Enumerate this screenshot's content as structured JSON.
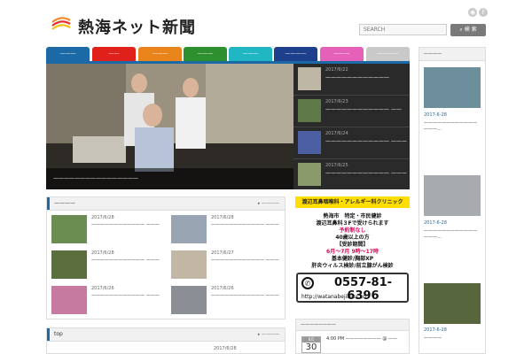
{
  "header": {
    "site_title": "熱海ネット新聞",
    "search_placeholder": "SEARCH",
    "search_button": "検 索",
    "rss_icon": "rss-icon",
    "facebook_icon": "facebook-icon"
  },
  "nav": {
    "tabs": [
      {
        "label": "———",
        "color": "#1b6aa7"
      },
      {
        "label": "——",
        "color": "#e0201a"
      },
      {
        "label": "———",
        "color": "#e8841a"
      },
      {
        "label": "———",
        "color": "#2e8f2e"
      },
      {
        "label": "———",
        "color": "#21b6c4"
      },
      {
        "label": "————",
        "color": "#1d3f8c"
      },
      {
        "label": "———",
        "color": "#e560b8"
      },
      {
        "label": "————",
        "color": "#c9c9c9"
      }
    ]
  },
  "slider": {
    "caption": "————————————————",
    "items": [
      {
        "date": "2017/6/22",
        "text": "————————————"
      },
      {
        "date": "2017/6/23",
        "text": "———————————— ——"
      },
      {
        "date": "2017/6/24",
        "text": "———————————— ———"
      },
      {
        "date": "2017/6/25",
        "text": "———————————— ———"
      }
    ]
  },
  "section1": {
    "title": "————",
    "more": "▸ ————",
    "cards": [
      {
        "date": "2017/6/28",
        "text": "———————————— ———"
      },
      {
        "date": "2017/6/28",
        "text": "———————————— ———"
      },
      {
        "date": "2017/6/28",
        "text": "———————————— ———"
      },
      {
        "date": "2017/6/27",
        "text": "———————————— ———"
      },
      {
        "date": "2017/6/26",
        "text": "———————————— ———"
      },
      {
        "date": "2017/6/26",
        "text": "———————————— ———"
      }
    ]
  },
  "section2": {
    "title": "top",
    "more": "▸ ————",
    "card_date": "2017/6/28"
  },
  "ad": {
    "head": "渡辺耳鼻咽喉科・アレルギー科クリニック",
    "line1": "熱海市　特定・市民健診",
    "line2": "渡辺耳鼻科３Fで受けられます",
    "line3": "予約制なし",
    "line4": "40歳以上の方",
    "line5": "【受診期間】",
    "line6": "6月～7月 9時～17時",
    "line7": "基本健診/胸部XP",
    "line8": "肝炎ウィルス検診/前立腺がん検診",
    "phone": "0557-81-6396",
    "url": "http://watanabejibika.co"
  },
  "calendar": {
    "title": "————————",
    "month": "6月",
    "day": "30",
    "event": "4:00 PM ———————— @ ——"
  },
  "sidebar": {
    "title": "————",
    "posts": [
      {
        "date": "2017-6-28",
        "text": "———————————— ———…"
      },
      {
        "date": "2017-6-28",
        "text": "———————————— ———…"
      },
      {
        "date": "2017-6-28",
        "text": "————"
      }
    ]
  },
  "colors": {
    "accent": "#1b6aa7",
    "ad_yellow": "#ffde00",
    "ad_red": "#e0005a"
  }
}
